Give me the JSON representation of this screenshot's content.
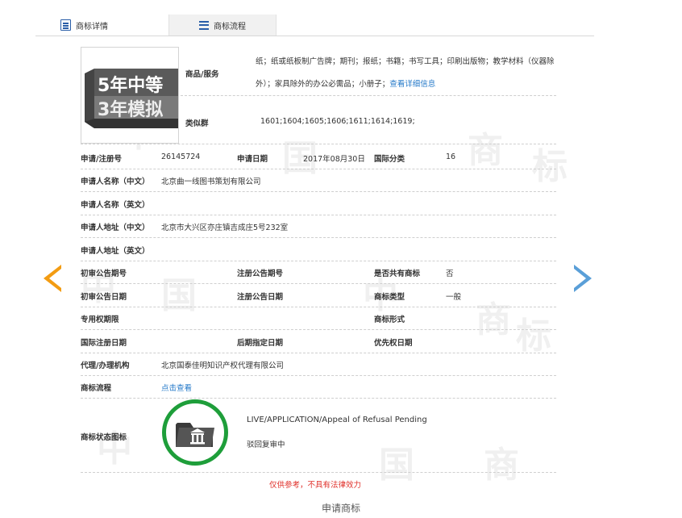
{
  "tabs": [
    {
      "label": "商标详情",
      "icon": "doc-icon"
    },
    {
      "label": "商标流程",
      "icon": "list-icon"
    }
  ],
  "logo": {
    "line1": "5年中等",
    "line2": "3年模拟"
  },
  "watermark": [
    "中",
    "国",
    "商",
    "标"
  ],
  "goods_services": {
    "label": "商品/服务",
    "text_line1": "纸；纸或纸板制广告牌；期刊；报纸；书籍；书写工具；印刷出版物；教学材料（仪器除",
    "text_line2": "外）；家具除外的办公必需品；小册子；",
    "link": "查看详细信息"
  },
  "similar_groups": {
    "label": "类似群",
    "value": "1601;1604;1605;1606;1611;1614;1619;"
  },
  "rows": {
    "reg_no": {
      "label": "申请/注册号",
      "value": "26145724"
    },
    "app_date": {
      "label": "申请日期",
      "value": "2017年08月30日"
    },
    "intl_class": {
      "label": "国际分类",
      "value": "16"
    },
    "applicant_cn": {
      "label": "申请人名称（中文）",
      "value": "北京曲一线图书策划有限公司"
    },
    "applicant_en": {
      "label": "申请人名称（英文）"
    },
    "address_cn": {
      "label": "申请人地址（中文）",
      "value": "北京市大兴区亦庄镇吉成庄5号232室"
    },
    "address_en": {
      "label": "申请人地址（英文）"
    },
    "prelim_no": {
      "label": "初审公告期号"
    },
    "reg_notice_no": {
      "label": "注册公告期号"
    },
    "shared": {
      "label": "是否共有商标",
      "value": "否"
    },
    "prelim_date": {
      "label": "初审公告日期"
    },
    "reg_notice_date": {
      "label": "注册公告日期"
    },
    "tm_type": {
      "label": "商标类型",
      "value": "一般"
    },
    "exclusive_period": {
      "label": "专用权期限"
    },
    "tm_form": {
      "label": "商标形式"
    },
    "intl_reg_date": {
      "label": "国际注册日期"
    },
    "later_designation": {
      "label": "后期指定日期"
    },
    "priority_date": {
      "label": "优先权日期"
    },
    "agent": {
      "label": "代理/办理机构",
      "value": "北京国泰佳明知识产权代理有限公司"
    },
    "flow": {
      "label": "商标流程",
      "link": "点击查看"
    },
    "status_icon": {
      "label": "商标状态图标"
    }
  },
  "status": {
    "en": "LIVE/APPLICATION/Appeal of Refusal Pending",
    "cn": "驳回复审中",
    "ring_color": "#1e9e3a"
  },
  "disclaimer": "仅供参考，不具有法律效力",
  "footer_link": "申请商标"
}
